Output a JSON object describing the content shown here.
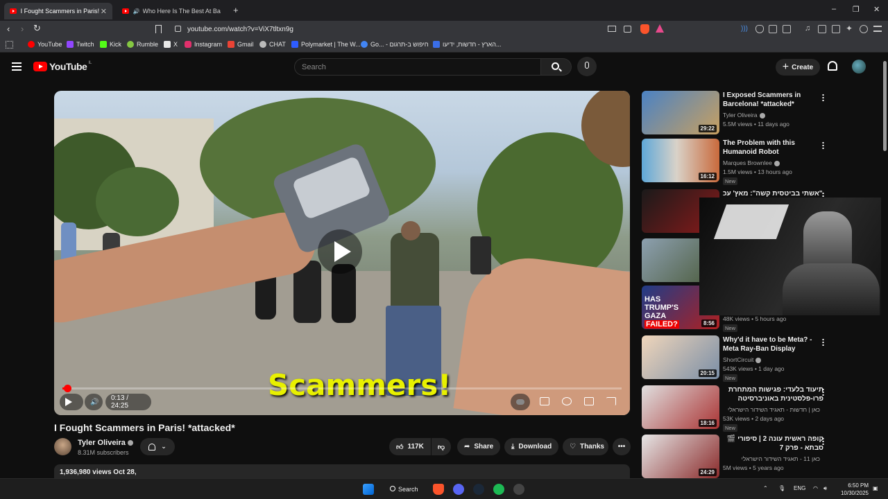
{
  "browser": {
    "tabs": [
      {
        "title": "I Fought Scammers in Paris! *atta",
        "active": true
      },
      {
        "title": "Who Here Is The Best At Basketb",
        "active": false
      }
    ],
    "new_tab": "+",
    "url": "youtube.com/watch?v=ViX7tltxn9g",
    "window_controls": {
      "minimize": "–",
      "maximize": "❐",
      "close": "✕"
    },
    "bookmarks": [
      {
        "label": "YouTube",
        "color": "#ff0000"
      },
      {
        "label": "Twitch",
        "color": "#9146ff"
      },
      {
        "label": "Kick",
        "color": "#53fc18"
      },
      {
        "label": "Rumble",
        "color": "#85c742"
      },
      {
        "label": "X",
        "color": "#e8e8e8"
      },
      {
        "label": "Instagram",
        "color": "#e1306c"
      },
      {
        "label": "Gmail",
        "color": "#ea4335"
      },
      {
        "label": "CHAT",
        "color": "#bbbbbb"
      },
      {
        "label": "Polymarket | The W...",
        "color": "#2e5cff"
      },
      {
        "label": "Go... - חיפוש ב-תרגום",
        "color": "#4285f4"
      },
      {
        "label": "הארץ - חדשות, ידיעו...",
        "color": "#3a6ee8"
      }
    ]
  },
  "youtube": {
    "logo_text": "YouTube",
    "country_code": "IL",
    "search_placeholder": "Search",
    "create_label": "Create",
    "accent": "#ff0000"
  },
  "video": {
    "title": "I Fought Scammers in Paris! *attacked*",
    "subtitle_caption": "Scammers!",
    "time": "0:13 / 24:25",
    "progress": 0.009,
    "channel": "Tyler Oliveira",
    "subscribers": "8.31M subscribers",
    "likes": "117K",
    "share_label": "Share",
    "download_label": "Download",
    "thanks_label": "Thanks",
    "views_date": "1,936,980 views  Oct 28,"
  },
  "recommendations": [
    {
      "title": "I Exposed Scammers in Barcelona! *attacked*",
      "channel": "Tyler Oliveira",
      "meta": "5.5M views • 11 days ago",
      "duration": "29:22",
      "new": "",
      "thumb": "#3b6fb0"
    },
    {
      "title": "The Problem with this Humanoid Robot",
      "channel": "Marques Brownlee",
      "meta": "1.5M views • 13 hours ago",
      "duration": "16:12",
      "new": "New",
      "thumb": "#3f93c8"
    },
    {
      "title": "\"אשתי בביטסית קשה\": מאץ' עכ",
      "channel": "",
      "meta": "",
      "duration": "",
      "new": "",
      "thumb": "#8a1a1a"
    },
    {
      "title": "",
      "channel": "",
      "meta": "",
      "duration": "",
      "new": "",
      "thumb": "#6b7f6a"
    },
    {
      "title": "",
      "channel": "",
      "meta": "48K views • 5 hours ago",
      "duration": "8:56",
      "new": "New",
      "thumb": "#1f3c88"
    },
    {
      "title": "Why'd it have to be Meta? - Meta Ray-Ban Display",
      "channel": "ShortCircuit",
      "meta": "543K views • 1 day ago",
      "duration": "20:15",
      "new": "New",
      "thumb": "#e9c9a8"
    },
    {
      "title": "תיעוד בלעדי: פגישות המתחרת פרו-פלסטינית באוניברסיטה היוקרה...",
      "channel": "כאן | חדשות - תאגיד השידור הישראלי",
      "meta": "53K views • 2 days ago",
      "duration": "18:16",
      "new": "New",
      "thumb": "#c8c8c8"
    },
    {
      "title": "קופה ראשית עונה 2 | סיפורי 🎬 סבתא - פרק 7",
      "channel": "כאן 11 - תאגיד השידור הישראלי",
      "meta": "5M views • 5 years ago",
      "duration": "24:29",
      "new": "",
      "thumb": "#d0d4da"
    }
  ],
  "taskbar": {
    "search_label": "Search",
    "lang": "ENG",
    "time": "6:50 PM",
    "date": "10/30/2025"
  }
}
